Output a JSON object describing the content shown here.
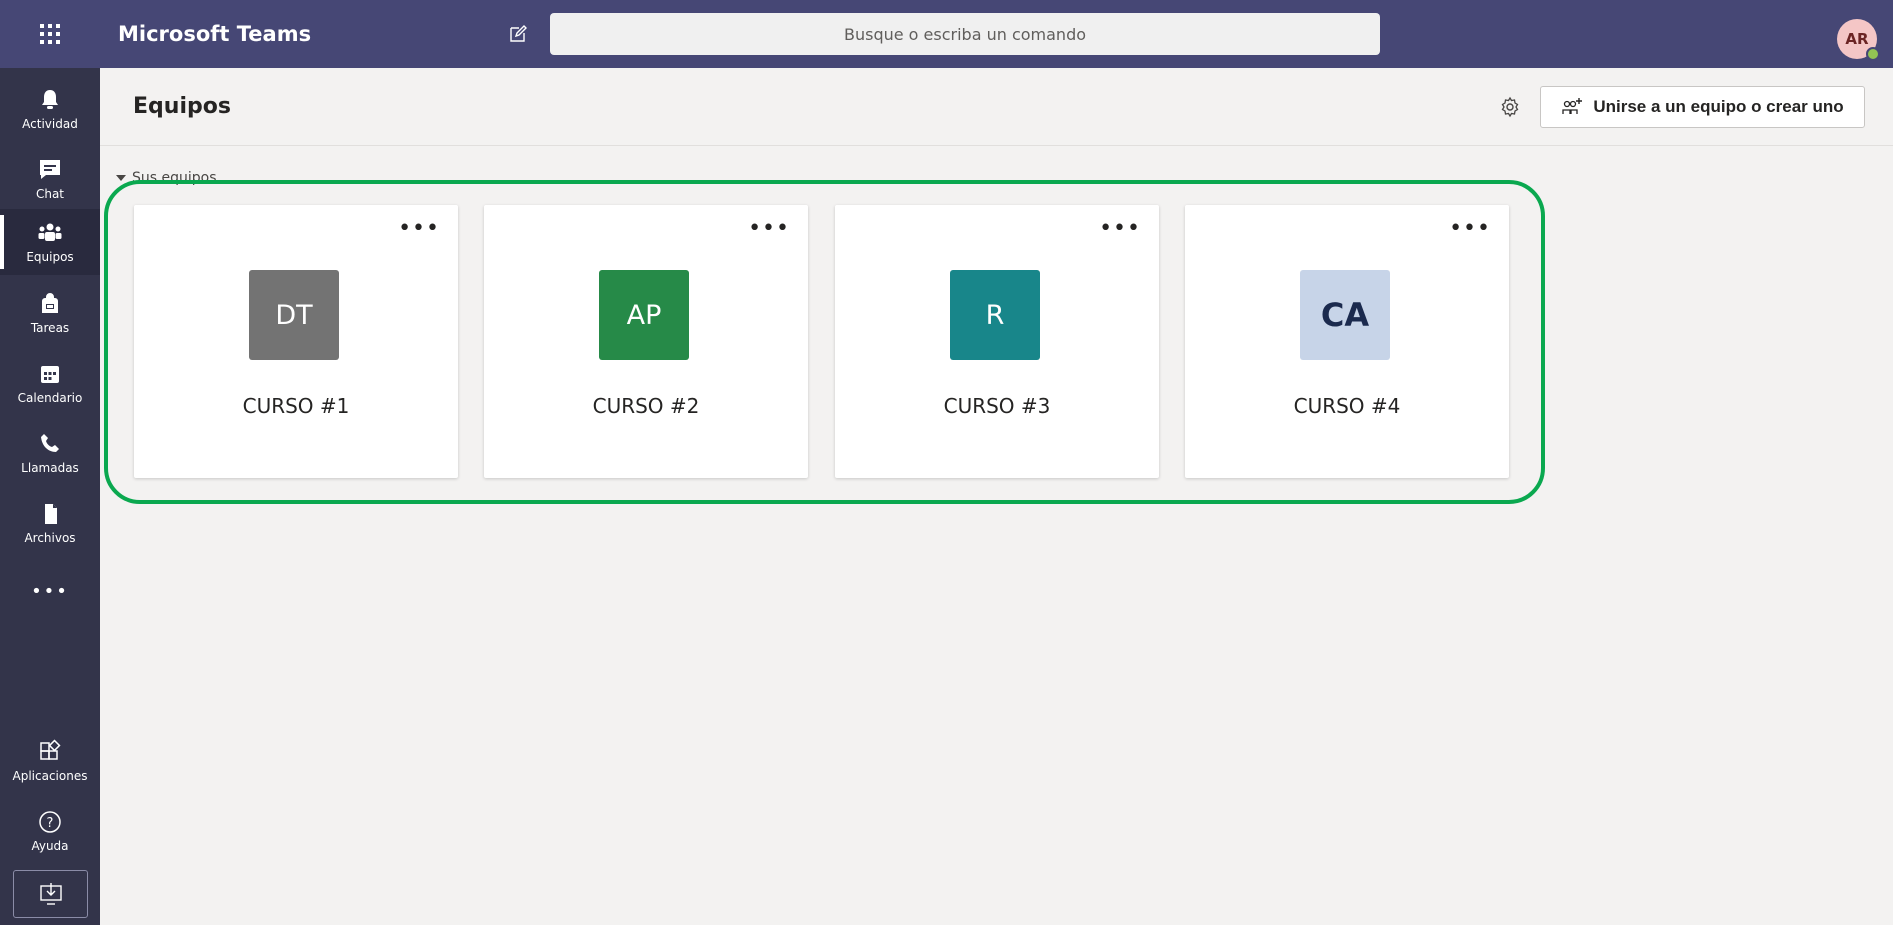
{
  "app": {
    "title": "Microsoft Teams"
  },
  "search": {
    "placeholder": "Busque o escriba un comando"
  },
  "user": {
    "initials": "AR"
  },
  "rail": {
    "items": [
      {
        "label": "Actividad",
        "icon": "bell-icon"
      },
      {
        "label": "Chat",
        "icon": "chat-icon"
      },
      {
        "label": "Equipos",
        "icon": "teams-icon"
      },
      {
        "label": "Tareas",
        "icon": "tasks-icon"
      },
      {
        "label": "Calendario",
        "icon": "calendar-icon"
      },
      {
        "label": "Llamadas",
        "icon": "phone-icon"
      },
      {
        "label": "Archivos",
        "icon": "file-icon"
      }
    ],
    "more": "•••",
    "bottom": [
      {
        "label": "Aplicaciones",
        "icon": "apps-icon"
      },
      {
        "label": "Ayuda",
        "icon": "help-icon"
      }
    ]
  },
  "header": {
    "title": "Equipos",
    "join_button": "Unirse a un equipo o crear uno"
  },
  "section": {
    "label": "Sus equipos"
  },
  "teams": [
    {
      "initials": "DT",
      "name": "CURSO #1",
      "color": "#737373",
      "text_color": "#ffffff"
    },
    {
      "initials": "AP",
      "name": "CURSO #2",
      "color": "#268a48",
      "text_color": "#ffffff"
    },
    {
      "initials": "R",
      "name": "CURSO #3",
      "color": "#18868a",
      "text_color": "#ffffff"
    },
    {
      "initials": "CA",
      "name": "CURSO #4",
      "color": "#c7d4e8",
      "text_color": "#1b2a4e"
    }
  ],
  "card_more": "•••",
  "colors": {
    "topbar": "#464775",
    "rail": "#33344a",
    "highlight": "#0aa84f"
  }
}
